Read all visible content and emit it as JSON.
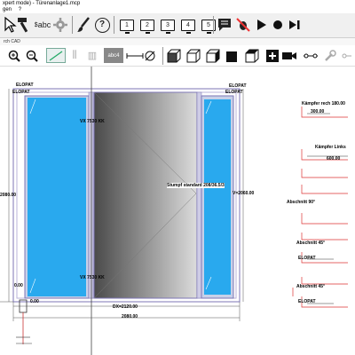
{
  "window": {
    "title": "xpert mode) - Türenanlage1.mcp"
  },
  "menu": {
    "items": [
      "gen",
      "?"
    ]
  },
  "toolbar": {
    "abc_label": "abc",
    "help_label": "?",
    "num_buttons": [
      "1",
      "2",
      "3",
      "4",
      "5"
    ]
  },
  "tab": {
    "label": "rch CAD"
  },
  "toolbar2": {
    "abc4_label": "abc4"
  },
  "drawing": {
    "elopat_tl1": "ELOPAT",
    "elopat_tl2": "ELOPAT",
    "elopat_tr1": "ELOPAT",
    "elopat_tr2": "ELOPAT",
    "vx_top": "VX 7530 KK",
    "vx_bottom": "VX 7530 KK",
    "stumpf": "Stumpf standard 208/36.5/3",
    "height_left": "2080.00",
    "height_right": "V=2060.00",
    "left_small": "0.00",
    "bottom_left": "0.00",
    "dx_dim": "DX=2120.00",
    "width_dim": "2080.00",
    "right_dim_small": ""
  },
  "profiles": {
    "kampfer_rech": "Kämpfer rech 180.00",
    "kampfer_rech_val": "300.00",
    "kampfer_links": "Kämpfer Links",
    "kampfer_links_val": "600.00",
    "abschnitt_90": "Abschnitt 90°",
    "abschnitt_45_1": "Abschnitt 45°",
    "elopat_1": "ELOPAT",
    "abschnitt_45_2": "Abschnitt 45°",
    "elopat_2": "ELOPAT"
  },
  "colors": {
    "glass": "#29a9ee",
    "door_dark": "#555555",
    "door_light": "#d8d8d8",
    "frame": "#b9b3d9"
  }
}
